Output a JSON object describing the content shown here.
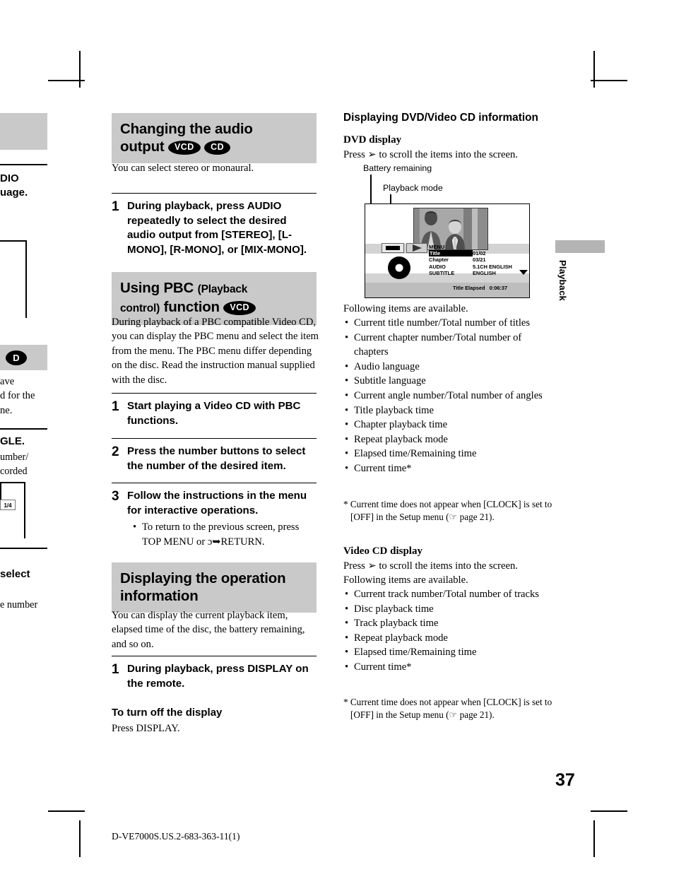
{
  "page": {
    "number": "37",
    "footer_code": "D-VE7000S.US.2-683-363-11(1)",
    "side_tab": "Playback"
  },
  "left_column": {
    "section1": {
      "heading_line1": "Changing the audio",
      "heading_line2": "output",
      "badges": [
        "VCD",
        "CD"
      ],
      "intro": "You can select stereo or monaural.",
      "steps": [
        {
          "number": "1",
          "text": "During playback, press AUDIO repeatedly to select the desired audio output from [STEREO], [L-MONO], [R-MONO], or [MIX-MONO]."
        }
      ]
    },
    "section2": {
      "heading_main1": "Using PBC",
      "heading_paren1": "(Playback",
      "heading_paren2": "control)",
      "heading_main2": "function",
      "badges": [
        "VCD"
      ],
      "intro": "During playback of a PBC compatible Video CD, you can display the PBC menu and select the item from the menu. The PBC menu differ depending on the disc. Read the instruction manual supplied with the disc.",
      "steps": [
        {
          "number": "1",
          "text": "Start playing a Video CD with PBC functions."
        },
        {
          "number": "2",
          "text": "Press the number buttons to select the number of the desired item."
        },
        {
          "number": "3",
          "text": "Follow the instructions in the menu for interactive operations."
        }
      ],
      "step3_bullet": "To return to the previous screen, press TOP MENU or ɔ➥RETURN."
    },
    "section3": {
      "heading_line1": "Displaying the operation",
      "heading_line2": "information",
      "intro": "You can display the current playback item, elapsed time of the disc, the battery remaining, and so on.",
      "steps": [
        {
          "number": "1",
          "text": "During playback, press DISPLAY on the remote."
        }
      ],
      "subhead": "To turn off the display",
      "subtext": "Press DISPLAY."
    }
  },
  "right_column": {
    "heading": "Displaying DVD/Video CD information",
    "dvd": {
      "subhead": "DVD display",
      "instruction": "Press ♥ to scroll the items into the screen.",
      "instruction_prefix": "Press",
      "instruction_suffix": "to scroll the items into the screen.",
      "callouts": [
        "Battery remaining",
        "Playback mode"
      ],
      "osd": {
        "menu_label": "MENU",
        "rows": [
          {
            "label": "Title",
            "value": "01/02",
            "selected": true
          },
          {
            "label": "Chapter",
            "value": "03/21",
            "selected": false
          },
          {
            "label": "AUDIO",
            "value": "5.1CH ENGLISH",
            "selected": false
          },
          {
            "label": "SUBTITLE",
            "value": "ENGLISH",
            "selected": false
          }
        ],
        "elapsed_label": "Title Elapsed",
        "elapsed_value": "0:06:37"
      },
      "list_intro": "Following items are available.",
      "items": [
        "Current title number/Total number of titles",
        "Current chapter number/Total number of chapters",
        "Audio language",
        "Subtitle language",
        "Current angle number/Total number of angles",
        "Title playback time",
        "Chapter playback time",
        "Repeat playback mode",
        "Elapsed time/Remaining time",
        "Current time*"
      ],
      "footnote": "* Current time does not appear when [CLOCK] is set to [OFF] in the Setup menu (☞ page 21)."
    },
    "vcd": {
      "subhead": "Video CD display",
      "instruction_prefix": "Press",
      "instruction_suffix": "to scroll the items into the screen.",
      "list_intro": "Following items are available.",
      "items": [
        "Current track number/Total number of tracks",
        "Disc playback time",
        "Track playback time",
        "Repeat playback mode",
        "Elapsed time/Remaining time",
        "Current time*"
      ],
      "footnote": "* Current time does not appear when [CLOCK] is set to [OFF] in the Setup menu (☞ page 21)."
    }
  },
  "left_bleed": {
    "frag1_line1": "DIO",
    "frag1_line2": "uage.",
    "frag2_line1": "ave",
    "frag2_line2": "d for the",
    "frag2_line3": "ne.",
    "frag3": "GLE.",
    "frag4_line1": "umber/",
    "frag4_line2": "corded",
    "frag5": "1/4",
    "frag6": " select",
    "frag7": "e number",
    "badge": "D"
  },
  "colors": {
    "banner_gray": "#c9c9c9",
    "tab_gray": "#b4b4b4",
    "osd_gray": "#d3d3d3",
    "scene_gray": "#9d9d9d",
    "ink": "#000000"
  }
}
